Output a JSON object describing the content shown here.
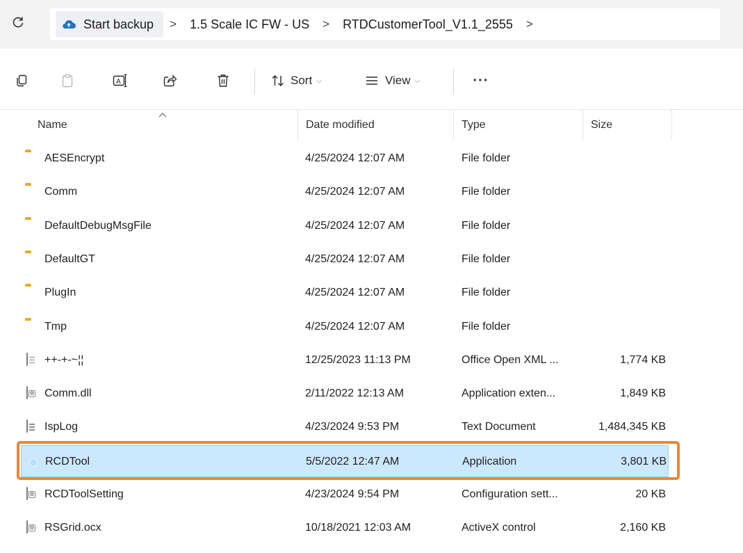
{
  "address": {
    "crumbs": [
      "Start backup",
      "1.5 Scale IC FW - US",
      "RTDCustomerTool_V1.1_2555"
    ],
    "separator": ">",
    "refresh_icon": "refresh-icon",
    "cloud_icon": "cloud-backup-icon"
  },
  "toolbar": {
    "sort_label": "Sort",
    "view_label": "View",
    "more_label": "···",
    "icons": [
      "copy-icon",
      "paste-icon",
      "rename-icon",
      "share-icon",
      "delete-icon",
      "sort-icon",
      "view-icon",
      "more-icon"
    ]
  },
  "columns": {
    "name": "Name",
    "date": "Date modified",
    "type": "Type",
    "size": "Size"
  },
  "files": [
    {
      "name": "AESEncrypt",
      "date": "4/25/2024 12:07 AM",
      "type": "File folder",
      "size": "",
      "icon": "folder-icon"
    },
    {
      "name": "Comm",
      "date": "4/25/2024 12:07 AM",
      "type": "File folder",
      "size": "",
      "icon": "folder-icon"
    },
    {
      "name": "DefaultDebugMsgFile",
      "date": "4/25/2024 12:07 AM",
      "type": "File folder",
      "size": "",
      "icon": "folder-icon"
    },
    {
      "name": "DefaultGT",
      "date": "4/25/2024 12:07 AM",
      "type": "File folder",
      "size": "",
      "icon": "folder-icon"
    },
    {
      "name": "PlugIn",
      "date": "4/25/2024 12:07 AM",
      "type": "File folder",
      "size": "",
      "icon": "folder-icon"
    },
    {
      "name": "Tmp",
      "date": "4/25/2024 12:07 AM",
      "type": "File folder",
      "size": "",
      "icon": "folder-icon"
    },
    {
      "name": "++-+-~¦¦",
      "date": "12/25/2023 11:13 PM",
      "type": "Office Open XML ...",
      "size": "1,774 KB",
      "icon": "document-icon"
    },
    {
      "name": "Comm.dll",
      "date": "2/11/2022 12:13 AM",
      "type": "Application exten...",
      "size": "1,849 KB",
      "icon": "dll-file-icon"
    },
    {
      "name": "IspLog",
      "date": "4/23/2024 9:53 PM",
      "type": "Text Document",
      "size": "1,484,345 KB",
      "icon": "text-document-icon"
    },
    {
      "name": "RCDTool",
      "date": "5/5/2022 12:47 AM",
      "type": "Application",
      "size": "3,801 KB",
      "icon": "application-icon",
      "selected": true
    },
    {
      "name": "RCDToolSetting",
      "date": "4/23/2024 9:54 PM",
      "type": "Configuration sett...",
      "size": "20 KB",
      "icon": "settings-file-icon"
    },
    {
      "name": "RSGrid.ocx",
      "date": "10/18/2021 12:03 AM",
      "type": "ActiveX control",
      "size": "2,160 KB",
      "icon": "activex-file-icon"
    }
  ],
  "colors": {
    "selection_fill": "#cce8ff",
    "highlight_ring": "#e8883a",
    "folder": "#f5c245"
  }
}
